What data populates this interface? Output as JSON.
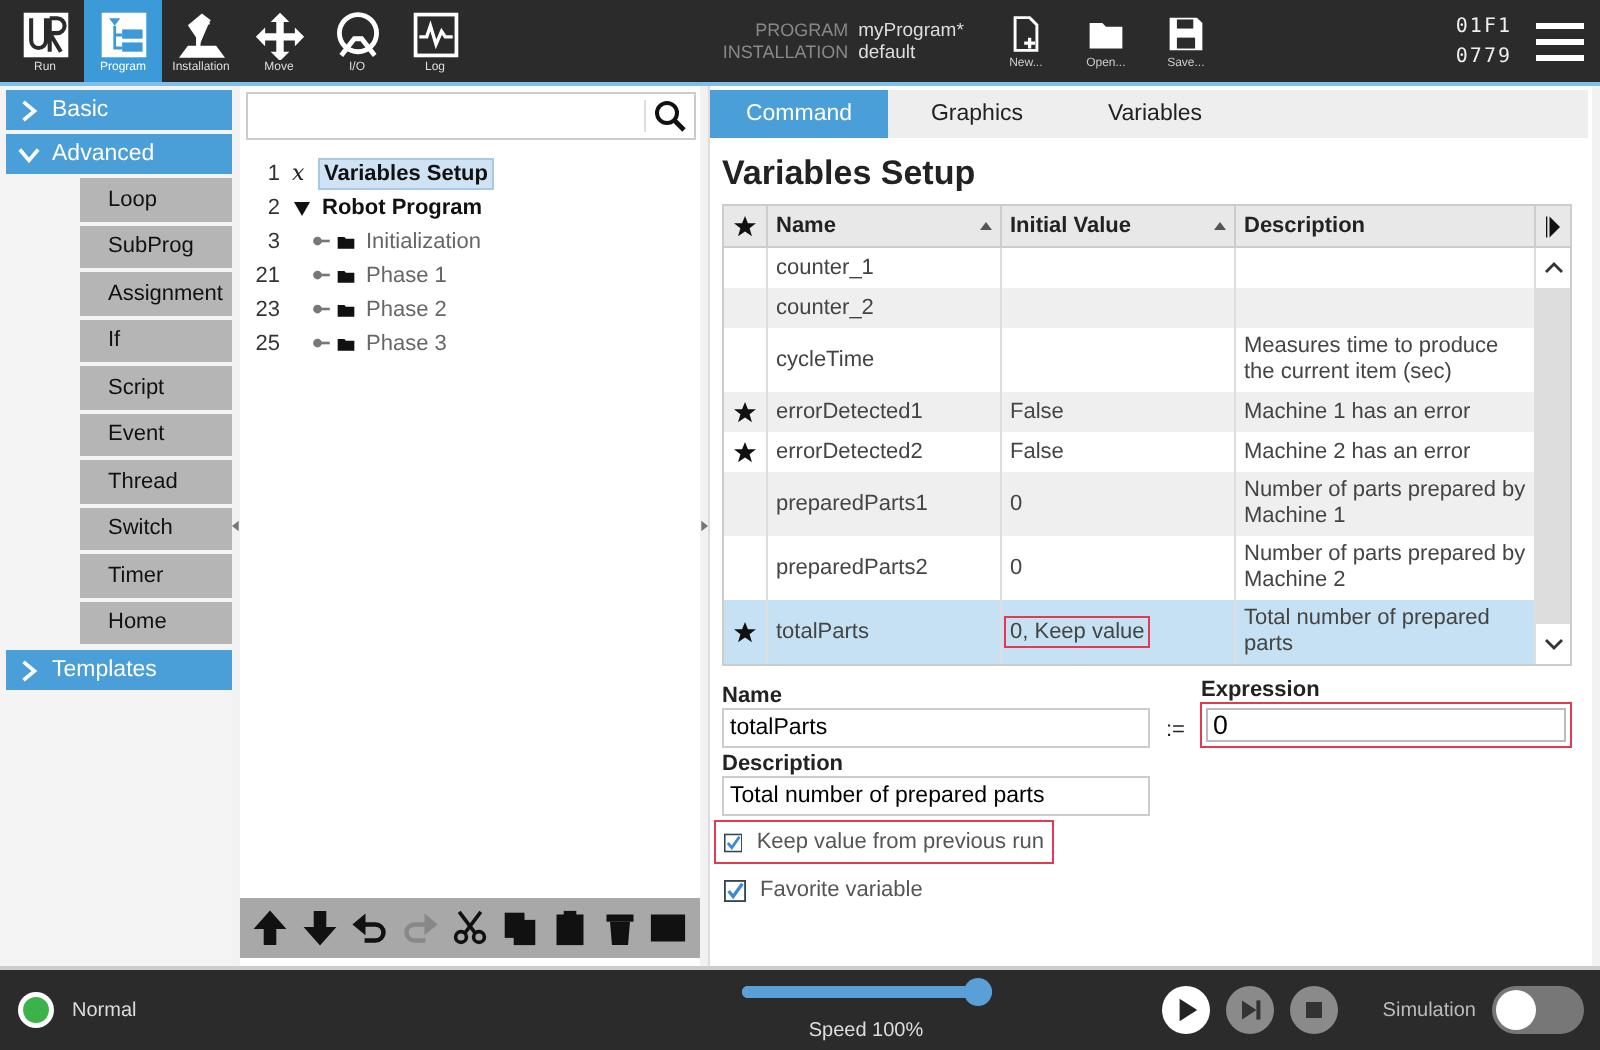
{
  "top_bar": {
    "nav": [
      {
        "label": "Run",
        "selected": false
      },
      {
        "label": "Program",
        "selected": true
      },
      {
        "label": "Installation",
        "selected": false
      },
      {
        "label": "Move",
        "selected": false
      },
      {
        "label": "I/O",
        "selected": false
      },
      {
        "label": "Log",
        "selected": false
      }
    ],
    "program_label": "PROGRAM",
    "program_value": "myProgram*",
    "installation_label": "INSTALLATION",
    "installation_value": "default",
    "file_buttons": [
      "New...",
      "Open...",
      "Save..."
    ],
    "code_lines": [
      "01F1",
      "0779"
    ]
  },
  "sidebar": {
    "groups": [
      {
        "label": "Basic",
        "expanded": false
      },
      {
        "label": "Advanced",
        "expanded": true,
        "items": [
          "Loop",
          "SubProg",
          "Assignment",
          "If",
          "Script",
          "Event",
          "Thread",
          "Switch",
          "Timer",
          "Home"
        ]
      },
      {
        "label": "Templates",
        "expanded": false
      }
    ]
  },
  "tree": {
    "nodes": [
      {
        "line": "1",
        "symbol": "x",
        "label": "Variables Setup",
        "kind": "variables",
        "selected": true
      },
      {
        "line": "2",
        "label": "Robot Program",
        "kind": "program",
        "selected": false,
        "expanded": true,
        "children": [
          {
            "line": "3",
            "label": "Initialization",
            "kind": "folder",
            "selected": false,
            "expanded": false
          },
          {
            "line": "21",
            "label": "Phase 1",
            "kind": "folder",
            "selected": false,
            "expanded": false
          },
          {
            "line": "23",
            "label": "Phase 2",
            "kind": "folder",
            "selected": false,
            "expanded": false
          },
          {
            "line": "25",
            "label": "Phase 3",
            "kind": "folder",
            "selected": false,
            "expanded": false
          }
        ]
      }
    ],
    "toolbar": [
      {
        "disabled": false
      },
      {
        "disabled": false
      },
      {
        "disabled": false
      },
      {
        "disabled": true
      },
      {
        "disabled": false
      },
      {
        "disabled": false
      },
      {
        "disabled": false
      },
      {
        "disabled": false
      },
      {
        "disabled": false
      }
    ]
  },
  "tabs": [
    {
      "label": "Command",
      "selected": true
    },
    {
      "label": "Graphics",
      "selected": false
    },
    {
      "label": "Variables",
      "selected": false
    }
  ],
  "title": "Variables Setup",
  "table": {
    "columns": [
      {
        "label": "Name",
        "sortable": true
      },
      {
        "label": "Initial Value",
        "sortable": true
      },
      {
        "label": "Description",
        "sortable": false
      }
    ],
    "rows": [
      {
        "favorite": false,
        "name": "counter_1",
        "initial_value": "",
        "description": "",
        "selected": false,
        "highlighted": false
      },
      {
        "favorite": false,
        "name": "counter_2",
        "initial_value": "",
        "description": "",
        "selected": false,
        "highlighted": false
      },
      {
        "favorite": false,
        "name": "cycleTime",
        "initial_value": "",
        "description": "Measures time to produce the current item (sec)",
        "selected": false,
        "highlighted": false
      },
      {
        "favorite": true,
        "name": "errorDetected1",
        "initial_value": "False",
        "description": "Machine 1 has an error",
        "selected": false,
        "highlighted": false
      },
      {
        "favorite": true,
        "name": "errorDetected2",
        "initial_value": "False",
        "description": "Machine 2 has an error",
        "selected": false,
        "highlighted": false
      },
      {
        "favorite": false,
        "name": "preparedParts1",
        "initial_value": "0",
        "description": "Number of parts prepared by Machine 1",
        "selected": false,
        "highlighted": false
      },
      {
        "favorite": false,
        "name": "preparedParts2",
        "initial_value": "0",
        "description": "Number of parts prepared by Machine 2",
        "selected": false,
        "highlighted": false
      },
      {
        "favorite": true,
        "name": "totalParts",
        "initial_value": "0, Keep value",
        "description": "Total number of prepared parts",
        "selected": true,
        "highlighted": true
      }
    ]
  },
  "form": {
    "name_label": "Name",
    "name_value": "totalParts",
    "assign_symbol": ":=",
    "expression_label": "Expression",
    "expression_value": "0",
    "expression_highlighted": true,
    "description_label": "Description",
    "description_value": "Total number of prepared parts",
    "checkboxes": [
      {
        "label": "Keep value from previous run",
        "checked": true,
        "highlighted": true
      },
      {
        "label": "Favorite variable",
        "checked": true,
        "highlighted": false
      }
    ]
  },
  "status_bar": {
    "status": "Normal",
    "status_ok": true,
    "speed_label": "Speed 100%",
    "speed": {
      "level": 1.0
    },
    "simulation_label": "Simulation",
    "simulation_on": false
  }
}
